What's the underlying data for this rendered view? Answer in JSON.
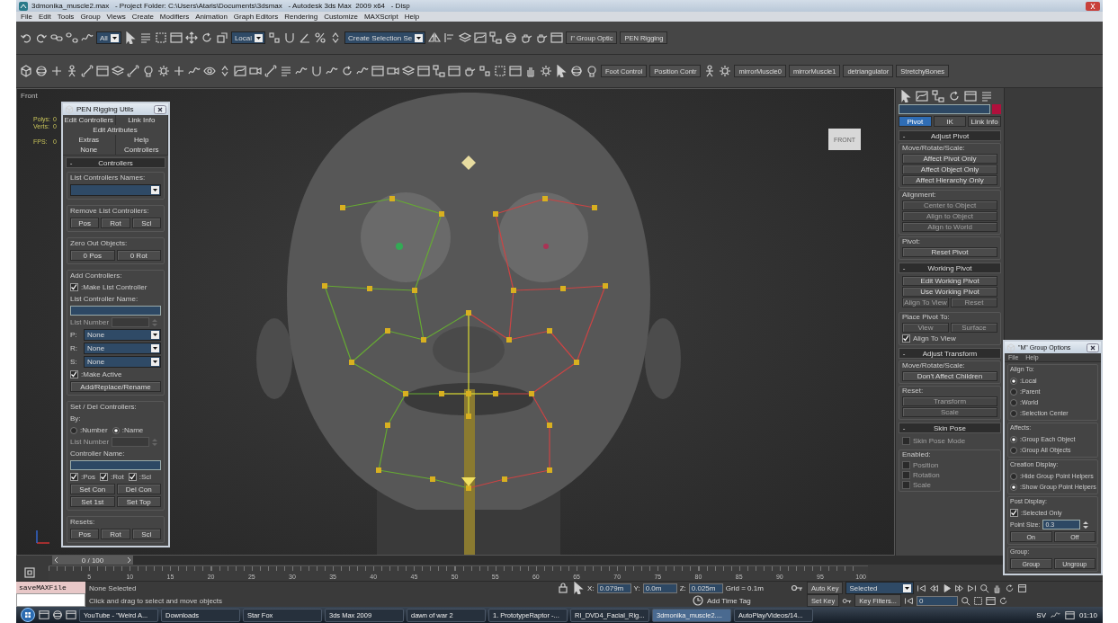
{
  "window": {
    "title": "3dmonika_muscle2.max   - Project Folder: C:\\Users\\Ataris\\Documents\\3dsmax   - Autodesk 3ds Max  2009 x64   - Disp"
  },
  "menu_bar": [
    "File",
    "Edit",
    "Tools",
    "Group",
    "Views",
    "Create",
    "Modifiers",
    "Animation",
    "Graph Editors",
    "Rendering",
    "Customize",
    "MAXScript",
    "Help"
  ],
  "main_toolbar": {
    "selection_filter": "All",
    "reference_coordinate": "Local",
    "named_selection": "Create Selection Se",
    "buttons": [
      "I\" Group Optic",
      "PEN Rigging"
    ]
  },
  "extras_toolbar": {
    "buttons": [
      "Foot Control",
      "Position Contr"
    ],
    "scripts": [
      "mirrorMuscle0",
      "mirrorMuscle1",
      "detriangulator",
      "StretchyBones"
    ]
  },
  "viewport": {
    "label": "Front",
    "stats": [
      {
        "label": "Polys:",
        "value": "0"
      },
      {
        "label": "Verts:",
        "value": "0"
      },
      {
        "label": "FPS:",
        "value": "0"
      }
    ],
    "viewcube": "FRONT"
  },
  "pen_rigging": {
    "title": "PEN Rigging Utils",
    "tab_rows": [
      [
        "Edit Controllers",
        "Link Info"
      ],
      [
        "Edit Attributes"
      ],
      [
        "Extras",
        "Help"
      ],
      [
        "None",
        "Controllers"
      ]
    ],
    "rollout": {
      "sign": "-",
      "title": "Controllers",
      "groups": [
        {
          "title": "List Controllers Names:",
          "controls": [
            {
              "kind": "dropdown"
            }
          ]
        },
        {
          "title": "Remove List Controllers:",
          "controls": [
            {
              "kind": "buttons",
              "labels": [
                "Pos",
                "Rot",
                "Scl"
              ],
              "disabled": false
            }
          ]
        },
        {
          "title": "Zero Out Objects:",
          "controls": [
            {
              "kind": "buttons",
              "labels": [
                "0 Pos",
                "0 Rot"
              ],
              "disabled": false
            }
          ]
        },
        {
          "title": "Add Controllers:",
          "controls": [
            {
              "kind": "checkbox",
              "label": ":Make List Controller",
              "checked": true,
              "disabled": false
            },
            {
              "kind": "label",
              "text": "List Controller Name:"
            },
            {
              "kind": "field"
            },
            {
              "kind": "spinner",
              "label": "List Number",
              "disabled": true
            },
            {
              "kind": "labeled_dropdown",
              "label": "P:",
              "value": "None"
            },
            {
              "kind": "labeled_dropdown",
              "label": "R:",
              "value": "None"
            },
            {
              "kind": "labeled_dropdown",
              "label": "S:",
              "value": "None"
            },
            {
              "kind": "checkbox",
              "label": ":Make Active",
              "checked": true,
              "disabled": false
            },
            {
              "kind": "buttons",
              "labels": [
                "Add/Replace/Rename"
              ],
              "disabled": false
            }
          ]
        },
        {
          "title": "Set / Del Controllers:",
          "controls": [
            {
              "kind": "label",
              "text": "By:"
            },
            {
              "kind": "radios",
              "inline": true,
              "options": [
                {
                  "label": ":Number",
                  "selected": false
                },
                {
                  "label": ":Name",
                  "selected": true
                }
              ]
            },
            {
              "kind": "spinner",
              "label": "List Number",
              "disabled": true
            },
            {
              "kind": "label",
              "text": "Controller Name:"
            },
            {
              "kind": "field"
            },
            {
              "kind": "checks",
              "items": [
                {
                  "label": ":Pos",
                  "checked": true
                },
                {
                  "label": ":Rot",
                  "checked": true
                },
                {
                  "label": ":Scl",
                  "checked": true
                }
              ]
            },
            {
              "kind": "buttons",
              "labels": [
                "Set Con",
                "Del Con"
              ],
              "disabled": false
            },
            {
              "kind": "buttons",
              "labels": [
                "Set 1st",
                "Set Top"
              ],
              "disabled": false
            }
          ]
        },
        {
          "title": "Resets:",
          "controls": [
            {
              "kind": "buttons",
              "labels": [
                "Pos",
                "Rot",
                "Scl"
              ],
              "disabled": false
            }
          ]
        }
      ]
    }
  },
  "command_panel": {
    "tabs": [
      {
        "label": "Pivot",
        "selected": true
      },
      {
        "label": "IK",
        "selected": false
      },
      {
        "label": "Link Info",
        "selected": false
      }
    ],
    "rollouts": [
      {
        "sign": "-",
        "title": "Adjust Pivot",
        "groups": [
          {
            "title": "Move/Rotate/Scale:",
            "controls": [
              {
                "kind": "buttons",
                "labels": [
                  "Affect Pivot Only"
                ],
                "disabled": false
              },
              {
                "kind": "buttons",
                "labels": [
                  "Affect Object Only"
                ],
                "disabled": false
              },
              {
                "kind": "buttons",
                "labels": [
                  "Affect Hierarchy Only"
                ],
                "disabled": false
              }
            ]
          },
          {
            "title": "Alignment:",
            "controls": [
              {
                "kind": "buttons",
                "labels": [
                  "Center to Object"
                ],
                "disabled": true
              },
              {
                "kind": "buttons",
                "labels": [
                  "Align to Object"
                ],
                "disabled": true
              },
              {
                "kind": "buttons",
                "labels": [
                  "Align to World"
                ],
                "disabled": true
              }
            ]
          },
          {
            "title": "Pivot:",
            "controls": [
              {
                "kind": "buttons",
                "labels": [
                  "Reset Pivot"
                ],
                "disabled": false
              }
            ]
          }
        ]
      },
      {
        "sign": "-",
        "title": "Working Pivot",
        "groups": [
          {
            "controls": [
              {
                "kind": "buttons",
                "labels": [
                  "Edit Working Pivot"
                ],
                "disabled": false
              },
              {
                "kind": "buttons",
                "labels": [
                  "Use Working Pivot"
                ],
                "disabled": false
              },
              {
                "kind": "buttons",
                "labels": [
                  "Align To View",
                  "Reset"
                ],
                "disabled": true
              }
            ]
          },
          {
            "title": "Place Pivot To:",
            "controls": [
              {
                "kind": "buttons",
                "labels": [
                  "View",
                  "Surface"
                ],
                "disabled": true
              },
              {
                "kind": "checkbox",
                "label": "Align To View",
                "checked": true,
                "disabled": false
              }
            ]
          }
        ]
      },
      {
        "sign": "-",
        "title": "Adjust Transform",
        "groups": [
          {
            "title": "Move/Rotate/Scale:",
            "controls": [
              {
                "kind": "buttons",
                "labels": [
                  "Don't Affect Children"
                ],
                "disabled": false
              }
            ]
          },
          {
            "title": "Reset:",
            "controls": [
              {
                "kind": "buttons",
                "labels": [
                  "Transform"
                ],
                "disabled": true
              },
              {
                "kind": "buttons",
                "labels": [
                  "Scale"
                ],
                "disabled": true
              }
            ]
          }
        ]
      },
      {
        "sign": "-",
        "title": "Skin Pose",
        "groups": [
          {
            "controls": [
              {
                "kind": "checkbox",
                "label": "Skin Pose Mode",
                "checked": false,
                "disabled": true
              }
            ]
          },
          {
            "title": "Enabled:",
            "controls": [
              {
                "kind": "checkbox",
                "label": "Position",
                "checked": false,
                "disabled": true
              },
              {
                "kind": "checkbox",
                "label": "Rotation",
                "checked": false,
                "disabled": true
              },
              {
                "kind": "checkbox",
                "label": "Scale",
                "checked": false,
                "disabled": true
              }
            ]
          }
        ]
      }
    ]
  },
  "group_options": {
    "title": "\"M\" Group Options",
    "menu": [
      "File",
      "Help"
    ],
    "groups": [
      {
        "title": "Align To:",
        "controls": [
          {
            "kind": "radios",
            "inline": false,
            "options": [
              {
                "label": ":Local",
                "selected": true
              },
              {
                "label": ":Parent",
                "selected": false
              },
              {
                "label": ":World",
                "selected": false
              },
              {
                "label": ":Selection Center",
                "selected": false
              }
            ]
          }
        ]
      },
      {
        "title": "Affects:",
        "controls": [
          {
            "kind": "radios",
            "inline": false,
            "options": [
              {
                "label": ":Group Each Object",
                "selected": true
              },
              {
                "label": ":Group All Objects",
                "selected": false
              }
            ]
          }
        ]
      },
      {
        "title": "Creation Display:",
        "controls": [
          {
            "kind": "radios",
            "inline": false,
            "options": [
              {
                "label": ":Hide Group Point Helpers",
                "selected": false
              },
              {
                "label": ":Show Group Point Helpers",
                "selected": true
              }
            ]
          }
        ]
      },
      {
        "title": "Post Display:",
        "controls": [
          {
            "kind": "checkbox",
            "label": ":Selected Only",
            "checked": true,
            "disabled": false
          },
          {
            "kind": "spinner",
            "label": "Point Size:",
            "value": "0.3",
            "disabled": false
          },
          {
            "kind": "buttons",
            "labels": [
              "On",
              "Off"
            ],
            "disabled": false
          }
        ]
      },
      {
        "title": "Group:",
        "controls": [
          {
            "kind": "buttons",
            "labels": [
              "Group",
              "Ungroup"
            ],
            "disabled": false
          }
        ]
      }
    ]
  },
  "timeline": {
    "position": "0 / 100",
    "ticks": [
      "5",
      "10",
      "15",
      "20",
      "25",
      "30",
      "35",
      "40",
      "45",
      "50",
      "55",
      "60",
      "65",
      "70",
      "75",
      "80",
      "85",
      "90",
      "95",
      "100"
    ]
  },
  "status_bar": {
    "listener": "saveMAXFile",
    "selection": "None Selected",
    "prompt": "Click and drag to select and move objects",
    "coords": [
      {
        "axis": "X:",
        "value": "0.079m"
      },
      {
        "axis": "Y:",
        "value": "0.0m"
      },
      {
        "axis": "Z:",
        "value": "0.025m"
      }
    ],
    "grid": "Grid = 0.1m",
    "time_tag": "Add Time Tag",
    "auto_key": "Auto Key",
    "key_mode": "Selected",
    "set_key": "Set Key",
    "key_filters": "Key Filters...",
    "frame": "0"
  },
  "taskbar": {
    "items": [
      {
        "label": "YouTube - \"Weird A...",
        "selected": false
      },
      {
        "label": "Downloads",
        "selected": false
      },
      {
        "label": "Star Fox",
        "selected": false
      },
      {
        "label": "3ds Max 2009",
        "selected": false
      },
      {
        "label": "dawn of war 2",
        "selected": false
      },
      {
        "label": "1. PrototypeRaptor -...",
        "selected": false
      },
      {
        "label": "RI_DVD4_Facial_Rig...",
        "selected": false
      },
      {
        "label": "3dmonika_muscle2....",
        "selected": true
      },
      {
        "label": "AutoPlay/Videos/14...",
        "selected": false
      }
    ],
    "tray": {
      "language": "SV",
      "clock": "01:10"
    }
  }
}
